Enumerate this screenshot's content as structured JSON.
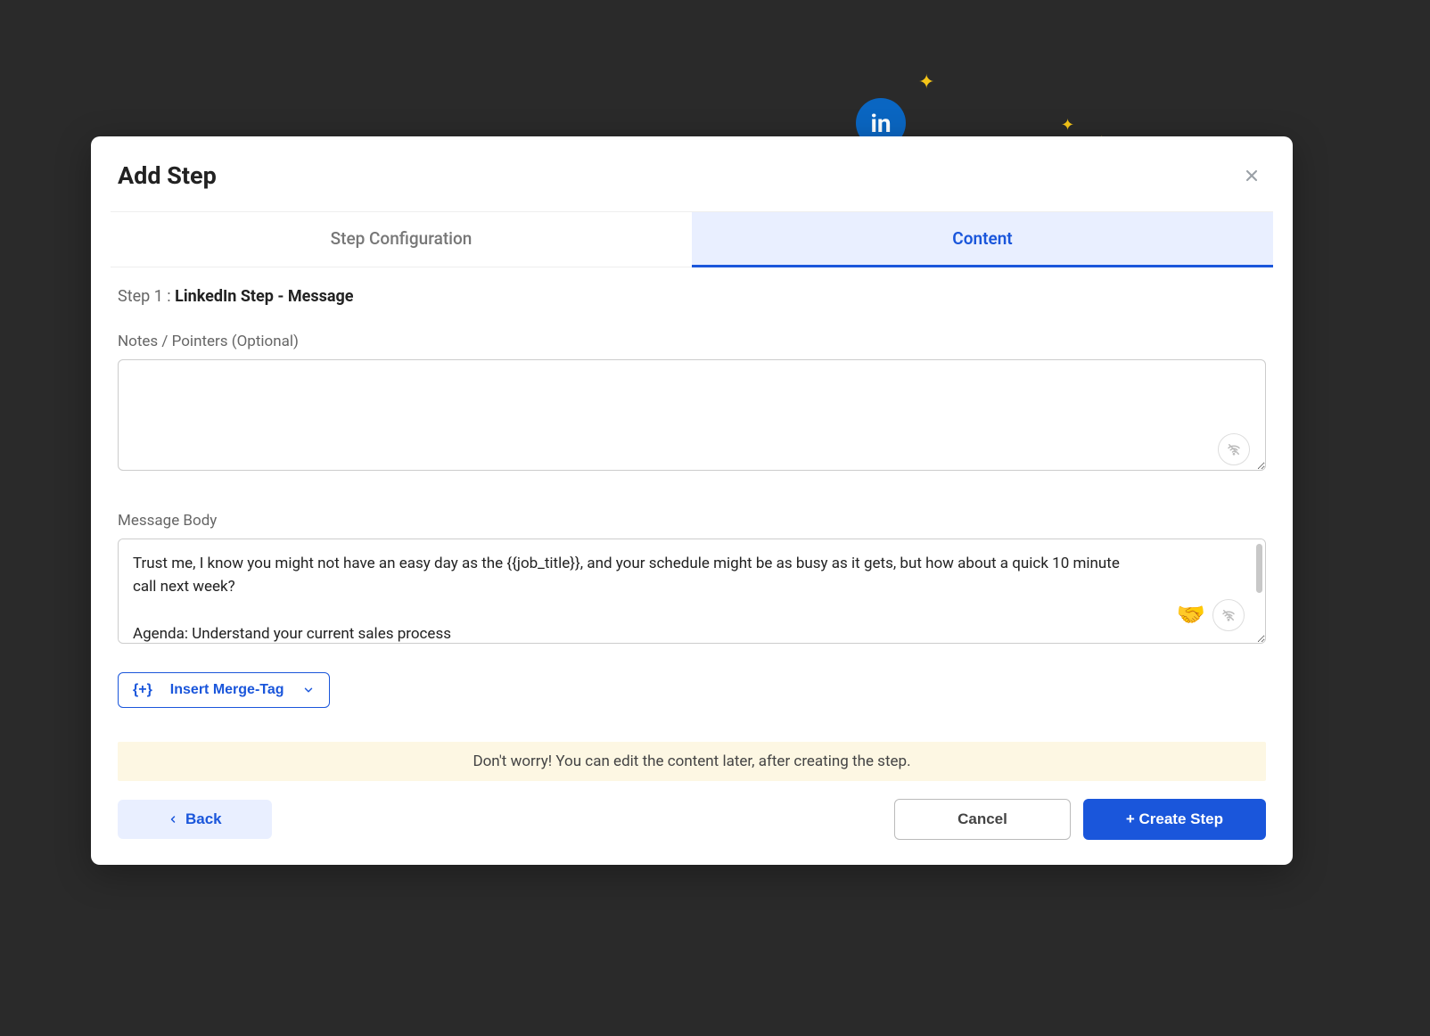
{
  "modal": {
    "title": "Add Step",
    "tabs": {
      "config": "Step Configuration",
      "content": "Content"
    },
    "step": {
      "prefix": "Step 1 : ",
      "name": "LinkedIn Step - Message"
    },
    "notes": {
      "label": "Notes / Pointers (Optional)",
      "value": ""
    },
    "message": {
      "label": "Message Body",
      "value": "Trust me, I know you might not have an easy day as the {{job_title}}, and your schedule might be as busy as it gets, but how about a quick 10 minute call next week?\n\nAgenda: Understand your current sales process"
    },
    "mergeTag": {
      "prefix": "{+}",
      "label": "Insert Merge-Tag"
    },
    "info": "Don't worry! You can edit the content later, after creating the step.",
    "buttons": {
      "back": "Back",
      "cancel": "Cancel",
      "create": "+ Create Step"
    }
  }
}
